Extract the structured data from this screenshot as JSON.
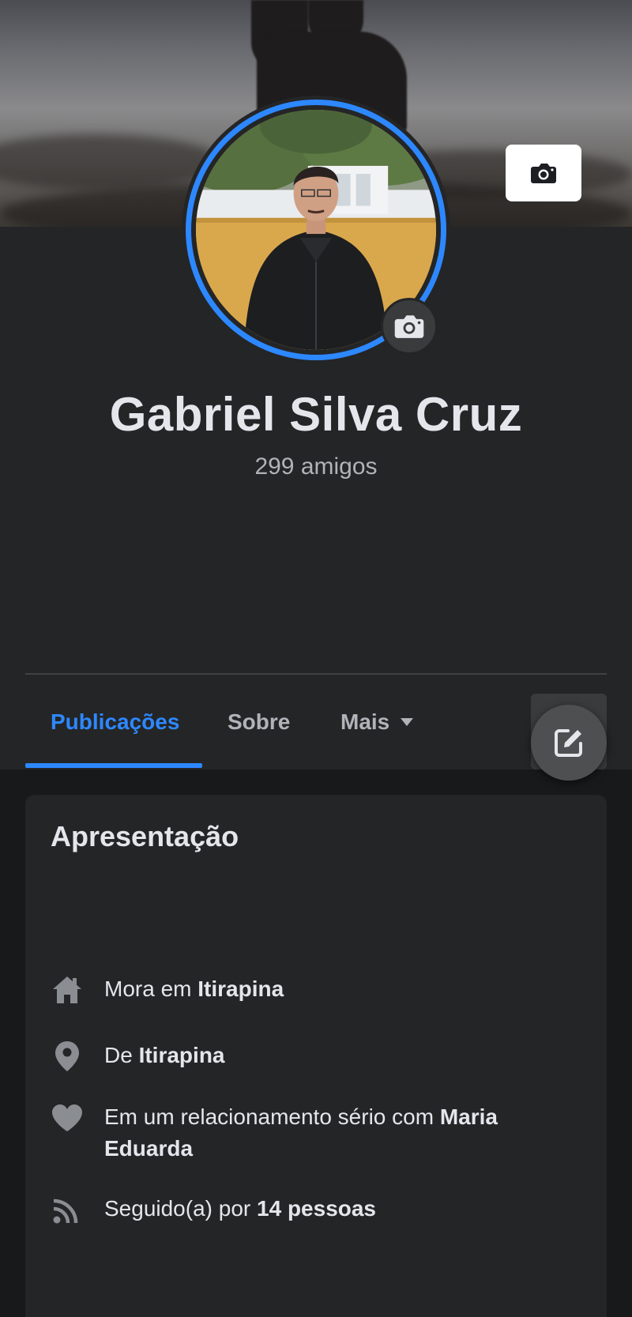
{
  "profile": {
    "name": "Gabriel Silva Cruz",
    "friends": "299 amigos"
  },
  "tabs": [
    {
      "label": "Publicações",
      "active": true
    },
    {
      "label": "Sobre",
      "active": false
    },
    {
      "label": "Mais",
      "active": false
    }
  ],
  "intro": {
    "title": "Apresentação",
    "items": [
      {
        "icon": "home-icon",
        "prefix": "Mora em ",
        "value": "Itirapina"
      },
      {
        "icon": "location-pin-icon",
        "prefix": "De ",
        "value": "Itirapina"
      },
      {
        "icon": "heart-icon",
        "prefix": "Em um relacionamento sério com ",
        "value": "Maria Eduarda"
      },
      {
        "icon": "rss-feed-icon",
        "prefix": "Seguido(a) por ",
        "value": "14 pessoas"
      }
    ]
  },
  "colors": {
    "accent": "#2d88ff",
    "background": "#18191a",
    "surface": "#242526",
    "text_primary": "#e4e6eb",
    "text_secondary": "#b0b3b8"
  }
}
